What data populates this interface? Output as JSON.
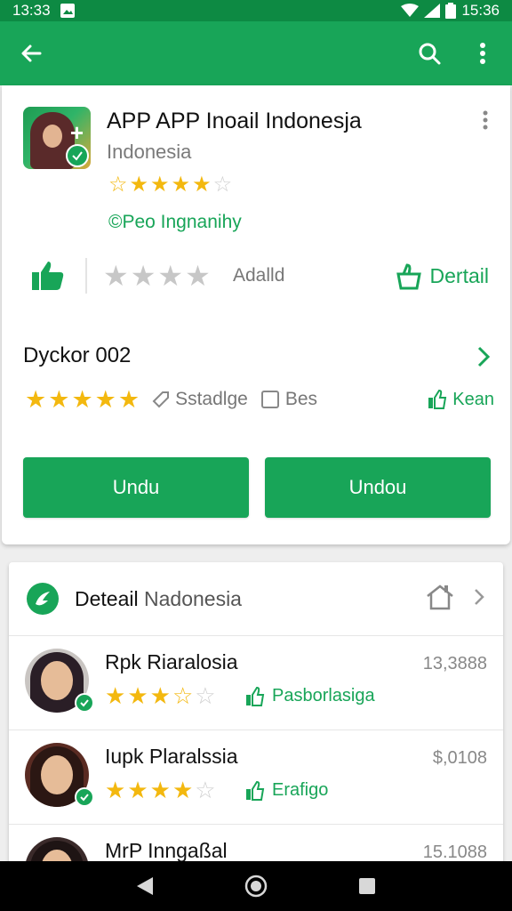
{
  "status_bar": {
    "time_left": "13:33",
    "time_right": "15:36"
  },
  "app_bar": {
    "back_icon": "arrow-left-icon",
    "search_icon": "search-icon",
    "more_icon": "more-vert-icon",
    "color": "#18a558"
  },
  "app": {
    "title": "APP APP Inoail Indonesja",
    "developer": "Indonesia",
    "rating_stars": 4.5,
    "badge_text": "©Pеo Ingnanihy",
    "added_label": "Adalld",
    "detail_label": "Dertail",
    "version_label": "Dyckor 002",
    "version_stars": 5,
    "tag_label": "Sstadlge",
    "bes_label": "Bes",
    "kean_label": "Kean",
    "button_1": "Undu",
    "button_2": "Undou"
  },
  "list": {
    "title_bold": "Deteail",
    "title_rest": "Nadonesia",
    "items": [
      {
        "name": "Rpk Riaralosia",
        "value": "13,3888",
        "rating": 3.5,
        "tag": "Pasborlasiga"
      },
      {
        "name": "Iupk Plaralssia",
        "value": "$,0108",
        "rating": 4,
        "tag": "Erafigo"
      },
      {
        "name": "MrP Inngaßal",
        "value": "15.1088",
        "rating": 0,
        "tag": ""
      }
    ]
  },
  "nav_bar": {
    "back_icon": "triangle-back-icon",
    "home_icon": "circle-home-icon",
    "recents_icon": "square-recents-icon"
  }
}
